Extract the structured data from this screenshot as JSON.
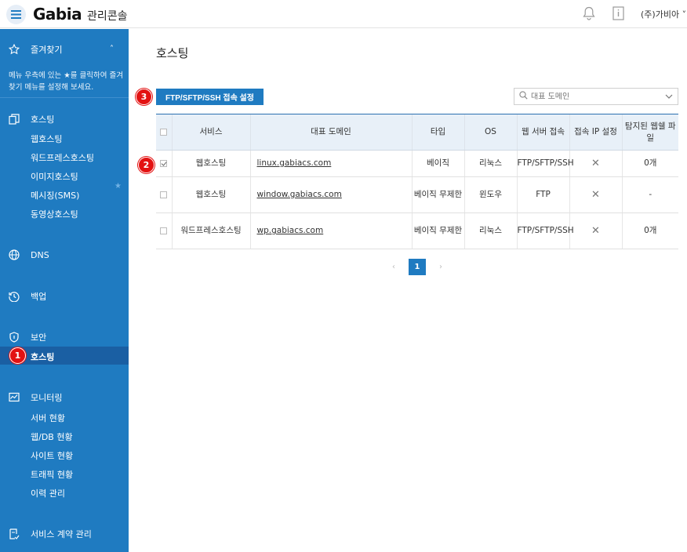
{
  "header": {
    "brand": "Gabia",
    "brand_sub": "관리콘솔",
    "user": "(주)가비아"
  },
  "sidebar": {
    "favorites_label": "즐겨찾기",
    "favorites_hint": "메뉴 우측에 있는 ★를 클릭하여 즐겨찾기 메뉴를 설정해 보세요.",
    "hosting": {
      "label": "호스팅",
      "items": [
        "웹호스팅",
        "워드프레스호스팅",
        "이미지호스팅",
        "메시징(SMS)",
        "동영상호스팅"
      ]
    },
    "dns_label": "DNS",
    "backup_label": "백업",
    "security": {
      "label": "보안",
      "items": [
        "호스팅"
      ]
    },
    "monitoring": {
      "label": "모니터링",
      "items": [
        "서버 현황",
        "웹/DB 현황",
        "사이트 현황",
        "트래픽 현황",
        "이력 관리"
      ]
    },
    "contract_label": "서비스 계약 관리"
  },
  "main": {
    "title": "호스팅",
    "ftp_button": "FTP/SFTP/SSH 접속 설정",
    "search_placeholder": "대표 도메인",
    "columns": [
      "서비스",
      "대표 도메인",
      "타입",
      "OS",
      "웹 서버 접속",
      "접속 IP 설정",
      "탐지된 웹쉘 파일"
    ],
    "rows": [
      {
        "service": "웹호스팅",
        "domain": "linux.gabiacs.com",
        "type": "베이직",
        "os": "리눅스",
        "access": "FTP/SFTP/SSH",
        "files": "0개",
        "checked": true
      },
      {
        "service": "웹호스팅",
        "domain": "window.gabiacs.com",
        "type": "베이직 무제한",
        "os": "윈도우",
        "access": "FTP",
        "files": "-",
        "checked": false
      },
      {
        "service": "워드프레스호스팅",
        "domain": "wp.gabiacs.com",
        "type": "베이직 무제한",
        "os": "리눅스",
        "access": "FTP/SFTP/SSH",
        "files": "0개",
        "checked": false
      }
    ],
    "page": "1"
  },
  "markers": [
    "1",
    "2",
    "3"
  ],
  "colors": {
    "accent": "#1f7bc1",
    "sidebar_active": "#1a5fa3",
    "marker": "#e31212"
  }
}
